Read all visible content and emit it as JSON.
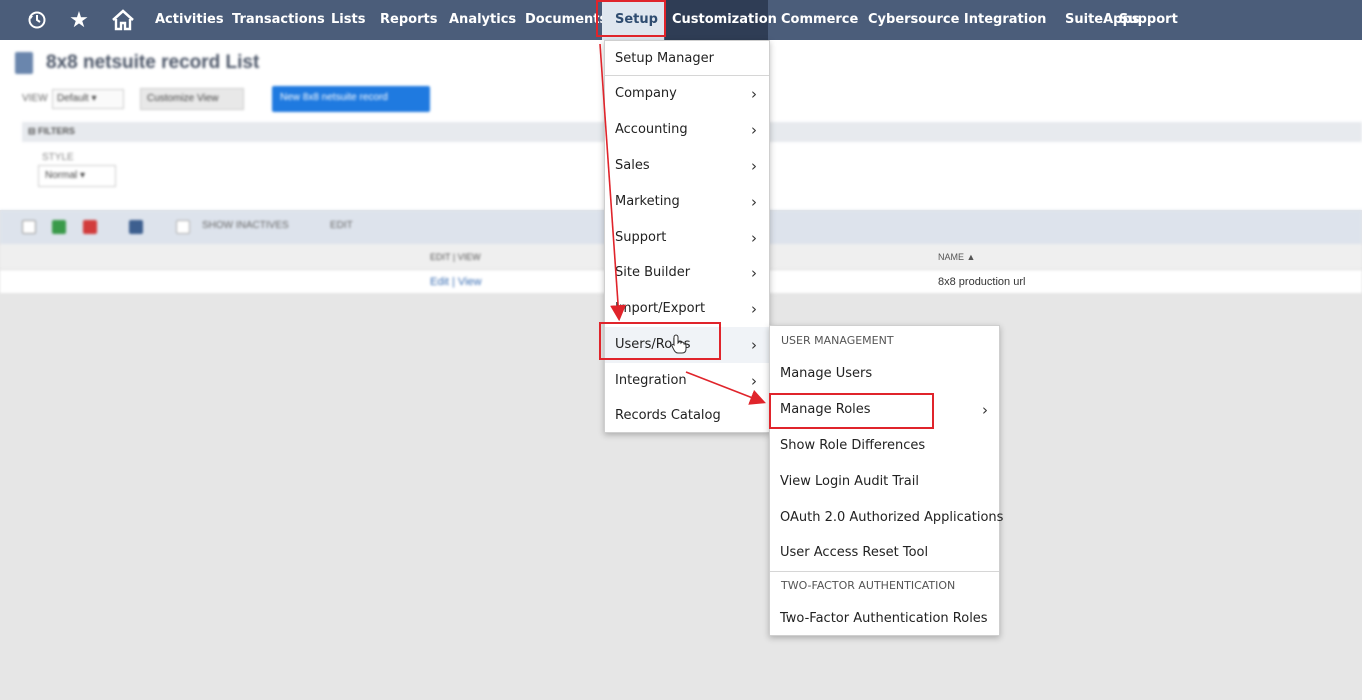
{
  "nav": {
    "icons": [
      "recent-history-icon",
      "star-icon",
      "home-icon"
    ],
    "items": [
      {
        "label": "Activities"
      },
      {
        "label": "Transactions"
      },
      {
        "label": "Lists"
      },
      {
        "label": "Reports"
      },
      {
        "label": "Analytics"
      },
      {
        "label": "Documents"
      },
      {
        "label": "Setup"
      },
      {
        "label": "Customization"
      },
      {
        "label": "Commerce"
      },
      {
        "label": "Cybersource Integration"
      },
      {
        "label": "SuiteApps"
      },
      {
        "label": "Support"
      }
    ],
    "colors": {
      "bar": "#4b5d7a",
      "active": "#dfe6ef",
      "highlight_box": "#e0242b"
    }
  },
  "page": {
    "title": "8x8 netsuite record List",
    "view_label": "VIEW",
    "view_value": "Default",
    "customize_view": "Customize View",
    "new_button": "New 8x8 netsuite record",
    "filters_label": "FILTERS",
    "filter_field_label": "STYLE",
    "filter_field_value": "Normal",
    "show_inactives": "SHOW INACTIVES",
    "edit_label": "EDIT",
    "columns": {
      "edit_view": "EDIT | VIEW",
      "name": "NAME ▲"
    },
    "row": {
      "edit_view": "Edit | View",
      "name": "8x8 production url"
    }
  },
  "setup_menu": {
    "items": [
      {
        "label": "Setup Manager",
        "has_submenu": false
      },
      {
        "label": "Company",
        "has_submenu": true
      },
      {
        "label": "Accounting",
        "has_submenu": true
      },
      {
        "label": "Sales",
        "has_submenu": true
      },
      {
        "label": "Marketing",
        "has_submenu": true
      },
      {
        "label": "Support",
        "has_submenu": true
      },
      {
        "label": "Site Builder",
        "has_submenu": true
      },
      {
        "label": "Import/Export",
        "has_submenu": true
      },
      {
        "label": "Users/Roles",
        "has_submenu": true
      },
      {
        "label": "Integration",
        "has_submenu": true
      },
      {
        "label": "Records Catalog",
        "has_submenu": false
      }
    ]
  },
  "users_roles_menu": {
    "section_user_management": "USER MANAGEMENT",
    "items": [
      {
        "label": "Manage Users"
      },
      {
        "label": "Manage Roles"
      },
      {
        "label": "Show Role Differences"
      },
      {
        "label": "View Login Audit Trail"
      },
      {
        "label": "OAuth 2.0 Authorized Applications"
      },
      {
        "label": "User Access Reset Tool"
      }
    ],
    "section_two_factor": "TWO-FACTOR AUTHENTICATION",
    "two_factor_item": "Two-Factor Authentication Roles"
  },
  "icons": {
    "chevron": "›",
    "star": "★",
    "cursor": "hand-pointer-icon"
  }
}
